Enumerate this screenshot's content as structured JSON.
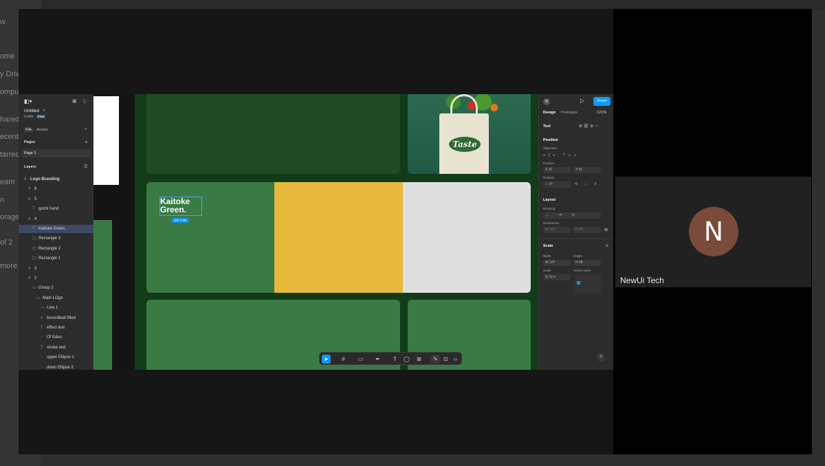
{
  "background_app": {
    "items": [
      "w",
      "ome",
      "y Driv",
      "ompu",
      "hared",
      "ecent",
      "tarred",
      "eam",
      "n",
      "orage",
      "of 2",
      "more"
    ]
  },
  "figma": {
    "file_name": "Untitled",
    "team": "Drafts",
    "plan_badge": "Free",
    "tabs": {
      "file": "File",
      "assets": "Assets"
    },
    "pages_header": "Pages",
    "page_item": "Page 1",
    "layers_header": "Layers",
    "layers": [
      {
        "label": "Logo Branding",
        "icon": "#",
        "indent": 0,
        "selected": false
      },
      {
        "label": "6",
        "icon": "#",
        "indent": 1,
        "selected": false
      },
      {
        "label": "5",
        "icon": "#",
        "indent": 1,
        "selected": false
      },
      {
        "label": "gochi hand",
        "icon": "T",
        "indent": 2,
        "selected": false
      },
      {
        "label": "4",
        "icon": "#",
        "indent": 1,
        "selected": false
      },
      {
        "label": "Kaitoke Green.",
        "icon": "T",
        "indent": 2,
        "selected": true
      },
      {
        "label": "Rectangle 3",
        "icon": "▢",
        "indent": 2,
        "selected": false
      },
      {
        "label": "Rectangle 2",
        "icon": "▢",
        "indent": 2,
        "selected": false
      },
      {
        "label": "Rectangle 1",
        "icon": "▢",
        "indent": 2,
        "selected": false
      },
      {
        "label": "3",
        "icon": "#",
        "indent": 1,
        "selected": false
      },
      {
        "label": "2",
        "icon": "#",
        "indent": 1,
        "selected": false
      },
      {
        "label": "Group 2",
        "icon": "▭",
        "indent": 2,
        "selected": false
      },
      {
        "label": "Main LOgo",
        "icon": "▭",
        "indent": 3,
        "selected": false
      },
      {
        "label": "Line 1",
        "icon": "—",
        "indent": 4,
        "selected": false
      },
      {
        "label": "bxcordleaf-filled",
        "icon": "#",
        "indent": 4,
        "selected": false
      },
      {
        "label": "effect text",
        "icon": "T",
        "indent": 4,
        "selected": false
      },
      {
        "label": "Of Eden",
        "icon": "◌",
        "indent": 4,
        "selected": false
      },
      {
        "label": "stroke text",
        "icon": "T",
        "indent": 4,
        "selected": false
      },
      {
        "label": "upper Ellipse 1",
        "icon": "◌",
        "indent": 4,
        "selected": false
      },
      {
        "label": "down Ellipse 2",
        "icon": "◌",
        "indent": 4,
        "selected": false
      }
    ],
    "canvas": {
      "logo_line1": "Kaitoke",
      "logo_line2": "Green.",
      "size_badge": "107 × 48",
      "bag_text": "Taste"
    },
    "props": {
      "user_initial": "N",
      "share": "Share",
      "tab_design": "Design",
      "tab_prototype": "Prototype",
      "zoom": "121%",
      "section_text": "Text",
      "section_position": "Position",
      "alignment": "Alignment",
      "position": "Position",
      "x_label": "X",
      "x_value": "37",
      "y_label": "Y",
      "y_value": "41",
      "rotation": "Rotation",
      "rotation_value": "0°",
      "section_layout": "Layout",
      "resizing": "Resizing",
      "dimensions": "Dimensions",
      "w_label": "W",
      "w_value": "107",
      "h_label": "H",
      "h_value": "48",
      "section_scale": "Scale",
      "width": "Width",
      "height": "Height",
      "scale_w_value": "107",
      "scale_h_value": "48",
      "scale": "Scale",
      "scale_value": "1x",
      "anchor_point": "Anchor point",
      "help": "?"
    }
  },
  "participant": {
    "initial": "N",
    "name": "NewUi Tech"
  },
  "colors": {
    "accent": "#0d99ff",
    "yellow_panel": "#e6b93c",
    "green": "#3a7a44",
    "dark_green": "#1f4a25",
    "avatar": "#7a4a3a"
  }
}
